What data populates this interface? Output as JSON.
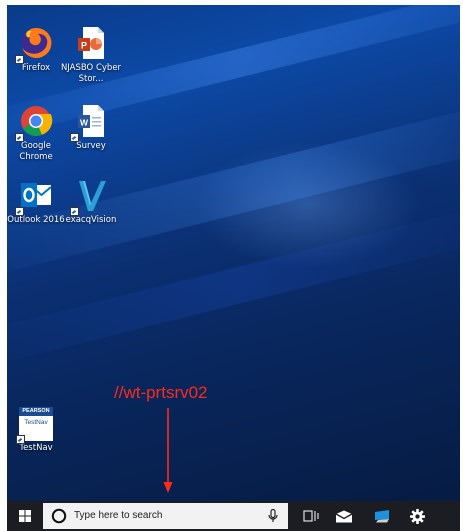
{
  "desktop": {
    "icons": [
      {
        "label": "Firefox",
        "icon": "firefox-icon"
      },
      {
        "label": "NJASBO Cyber Stor...",
        "icon": "powerpoint-file-icon"
      },
      {
        "label": "Google Chrome",
        "icon": "chrome-icon"
      },
      {
        "label": "Survey",
        "icon": "word-file-icon"
      },
      {
        "label": "Outlook 2016",
        "icon": "outlook-icon"
      },
      {
        "label": "exacqVision",
        "icon": "exacqvision-icon"
      },
      {
        "label": "TestNav",
        "icon": "testnav-icon",
        "logo_text": "PEARSON",
        "badge_text": "TestNav"
      }
    ]
  },
  "annotation": {
    "text": "//wt-prtsrv02",
    "color": "#ff2a1a"
  },
  "taskbar": {
    "start_icon": "windows-start-icon",
    "search_placeholder": "Type here to search",
    "search_icons": [
      "cortana-circle-icon",
      "microphone-icon"
    ],
    "pinned": [
      "task-view-icon",
      "mail-icon",
      "store-icon",
      "settings-gear-icon"
    ]
  },
  "colors": {
    "accent": "#0c4aa8",
    "taskbar": "#1b1d22",
    "annotation": "#ff2a1a"
  }
}
